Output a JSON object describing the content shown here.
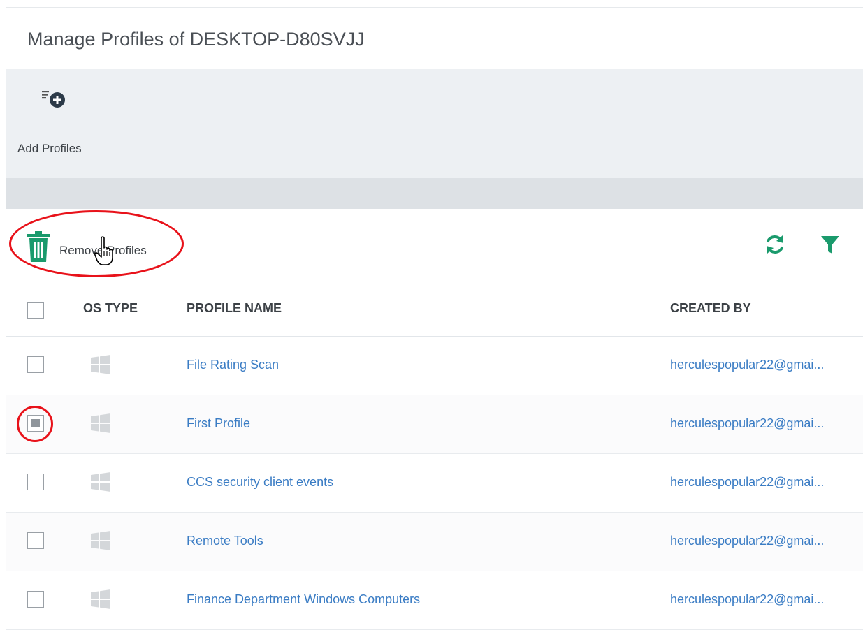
{
  "page": {
    "title": "Manage Profiles of DESKTOP-D80SVJJ"
  },
  "toolbar": {
    "add_profiles_label": "Add Profiles",
    "add_profiles_icon": "add-profile-icon"
  },
  "actions": {
    "remove_profiles_label": "Remove Profiles",
    "remove_icon": "trash-icon",
    "refresh_icon": "refresh-icon",
    "filter_icon": "filter-icon"
  },
  "table": {
    "columns": {
      "os_type": "OS TYPE",
      "profile_name": "PROFILE NAME",
      "created_by": "CREATED BY"
    },
    "rows": [
      {
        "os": "windows-icon",
        "name": "File Rating Scan",
        "created_by": "herculespopular22@gmai...",
        "checked": false
      },
      {
        "os": "windows-icon",
        "name": "First Profile",
        "created_by": "herculespopular22@gmai...",
        "checked": true
      },
      {
        "os": "windows-icon",
        "name": "CCS security client events",
        "created_by": "herculespopular22@gmai...",
        "checked": false
      },
      {
        "os": "windows-icon",
        "name": "Remote Tools",
        "created_by": "herculespopular22@gmai...",
        "checked": false
      },
      {
        "os": "windows-icon",
        "name": "Finance Department Windows Computers",
        "created_by": "herculespopular22@gmai...",
        "checked": false
      }
    ]
  },
  "colors": {
    "accent_green": "#1a9a6c",
    "link_blue": "#3a7cc4",
    "annotation_red": "#e8121a",
    "toolbar_bg": "#edf0f3",
    "windows_icon": "#d4d7da"
  }
}
